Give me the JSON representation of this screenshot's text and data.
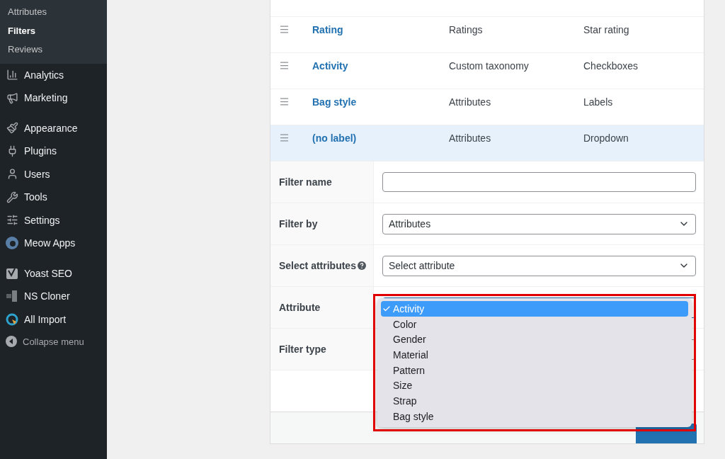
{
  "sidebar": {
    "submenu": [
      {
        "label": "Attributes",
        "selected": false
      },
      {
        "label": "Filters",
        "selected": true
      },
      {
        "label": "Reviews",
        "selected": false
      }
    ],
    "items": [
      {
        "label": "Analytics"
      },
      {
        "label": "Marketing"
      },
      {
        "label": "Appearance"
      },
      {
        "label": "Plugins"
      },
      {
        "label": "Users"
      },
      {
        "label": "Tools"
      },
      {
        "label": "Settings"
      },
      {
        "label": "Meow Apps"
      },
      {
        "label": "Yoast SEO"
      },
      {
        "label": "NS Cloner"
      },
      {
        "label": "All Import"
      }
    ],
    "collapse": "Collapse menu"
  },
  "filters": {
    "rows": [
      {
        "name": "Rating",
        "source": "Ratings",
        "type": "Star rating",
        "selected": false
      },
      {
        "name": "Activity",
        "source": "Custom taxonomy",
        "type": "Checkboxes",
        "selected": false
      },
      {
        "name": "Bag style",
        "source": "Attributes",
        "type": "Labels",
        "selected": false
      },
      {
        "name": "(no label)",
        "source": "Attributes",
        "type": "Dropdown",
        "selected": true
      }
    ],
    "form": [
      {
        "label": "Filter name",
        "kind": "text"
      },
      {
        "label": "Filter by",
        "kind": "select",
        "value": "Attributes"
      },
      {
        "label": "Select attributes",
        "kind": "select",
        "value": "Select attribute",
        "help": true
      },
      {
        "label": "Attribute",
        "kind": "select",
        "focused": true
      },
      {
        "label": "Filter type",
        "kind": "select"
      }
    ]
  },
  "dropdown": {
    "options": [
      {
        "label": "Activity",
        "selected": true
      },
      {
        "label": "Color",
        "selected": false
      },
      {
        "label": "Gender",
        "selected": false
      },
      {
        "label": "Material",
        "selected": false
      },
      {
        "label": "Pattern",
        "selected": false
      },
      {
        "label": "Size",
        "selected": false
      },
      {
        "label": "Strap",
        "selected": false
      },
      {
        "label": "Bag style",
        "selected": false
      }
    ]
  }
}
